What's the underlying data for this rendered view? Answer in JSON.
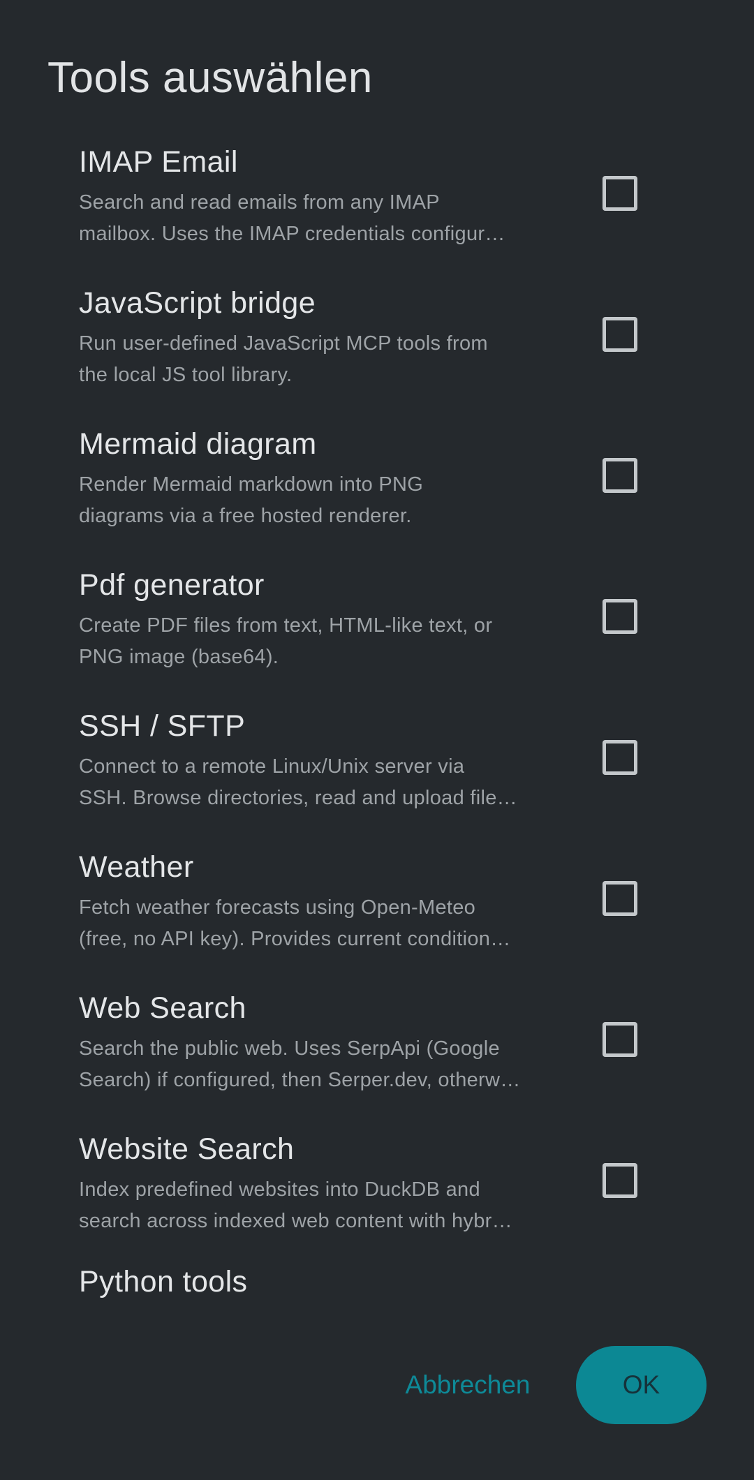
{
  "dialog": {
    "title": "Tools auswählen",
    "tools": [
      {
        "name": "IMAP Email",
        "desc_line1": "Search and read emails from any IMAP",
        "desc_line2": "mailbox. Uses the IMAP credentials configur…",
        "checked": false
      },
      {
        "name": "JavaScript bridge",
        "desc_line1": "Run user-defined JavaScript MCP tools from",
        "desc_line2": "the local JS tool library.",
        "checked": false
      },
      {
        "name": "Mermaid diagram",
        "desc_line1": "Render Mermaid markdown into PNG",
        "desc_line2": "diagrams via a free hosted renderer.",
        "checked": false
      },
      {
        "name": "Pdf generator",
        "desc_line1": "Create PDF files from text, HTML-like text, or",
        "desc_line2": "PNG image (base64).",
        "checked": false
      },
      {
        "name": "SSH / SFTP",
        "desc_line1": "Connect to a remote Linux/Unix server via",
        "desc_line2": "SSH. Browse directories, read and upload file…",
        "checked": false
      },
      {
        "name": "Weather",
        "desc_line1": "Fetch weather forecasts using Open-Meteo",
        "desc_line2": "(free, no API key). Provides current condition…",
        "checked": false
      },
      {
        "name": "Web Search",
        "desc_line1": "Search the public web. Uses SerpApi (Google",
        "desc_line2": "Search) if configured, then Serper.dev, otherw…",
        "checked": false
      },
      {
        "name": "Website Search",
        "desc_line1": "Index predefined websites into DuckDB and",
        "desc_line2": "search across indexed web content with hybr…",
        "checked": false
      }
    ],
    "section_header": "Python tools",
    "cancel_label": "Abbrechen",
    "ok_label": "OK"
  },
  "colors": {
    "background": "#25292d",
    "accent": "#0c8894",
    "text_primary": "#e4e6e8",
    "text_secondary": "#9ea3a7"
  }
}
